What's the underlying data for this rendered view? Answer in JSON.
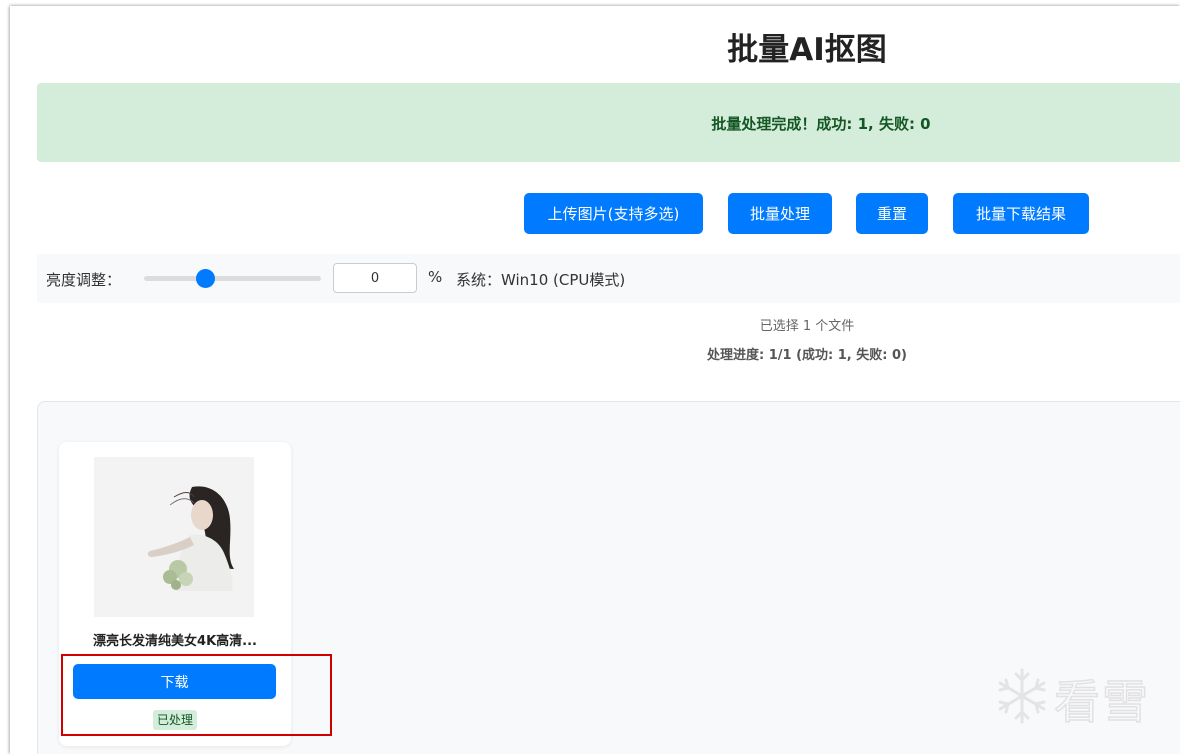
{
  "page": {
    "title": "批量AI抠图"
  },
  "alert": {
    "message": "批量处理完成！成功: 1, 失败: 0",
    "bg_color": "#d4edda",
    "text_color": "#155724"
  },
  "toolbar": {
    "upload_label": "上传图片(支持多选)",
    "batch_label": "批量处理",
    "reset_label": "重置",
    "download_all_label": "批量下载结果",
    "accent_color": "#007bff"
  },
  "controls": {
    "brightness_label": "亮度调整：",
    "brightness_value": "0",
    "slider_level_percent": 35,
    "unit": "%",
    "system_info": "系统：Win10 (CPU模式)"
  },
  "status": {
    "file_count": "已选择 1 个文件",
    "progress": "处理进度: 1/1 (成功: 1, 失败: 0)"
  },
  "results": {
    "items": [
      {
        "file_name": "漂亮长发清纯美女4K高清...",
        "download_label": "下载",
        "status": "已处理"
      }
    ]
  },
  "watermark": {
    "text": "看雪",
    "icon": "snowflake-icon"
  }
}
